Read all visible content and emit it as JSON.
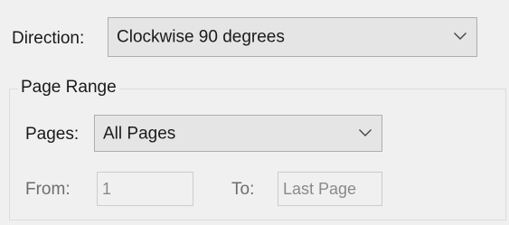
{
  "direction": {
    "label": "Direction:",
    "selected": "Clockwise 90 degrees"
  },
  "page_range": {
    "title": "Page Range",
    "pages_label": "Pages:",
    "pages_selected": "All Pages",
    "from_label": "From:",
    "from_value": "1",
    "to_label": "To:",
    "to_value": "Last Page"
  },
  "colors": {
    "dialog_background": "#f0f0f0",
    "combo_background": "#e5e5e5",
    "combo_border": "#adadad",
    "disabled_text": "#8a8a8a"
  },
  "icons": {
    "dropdown": "chevron-down-icon"
  }
}
